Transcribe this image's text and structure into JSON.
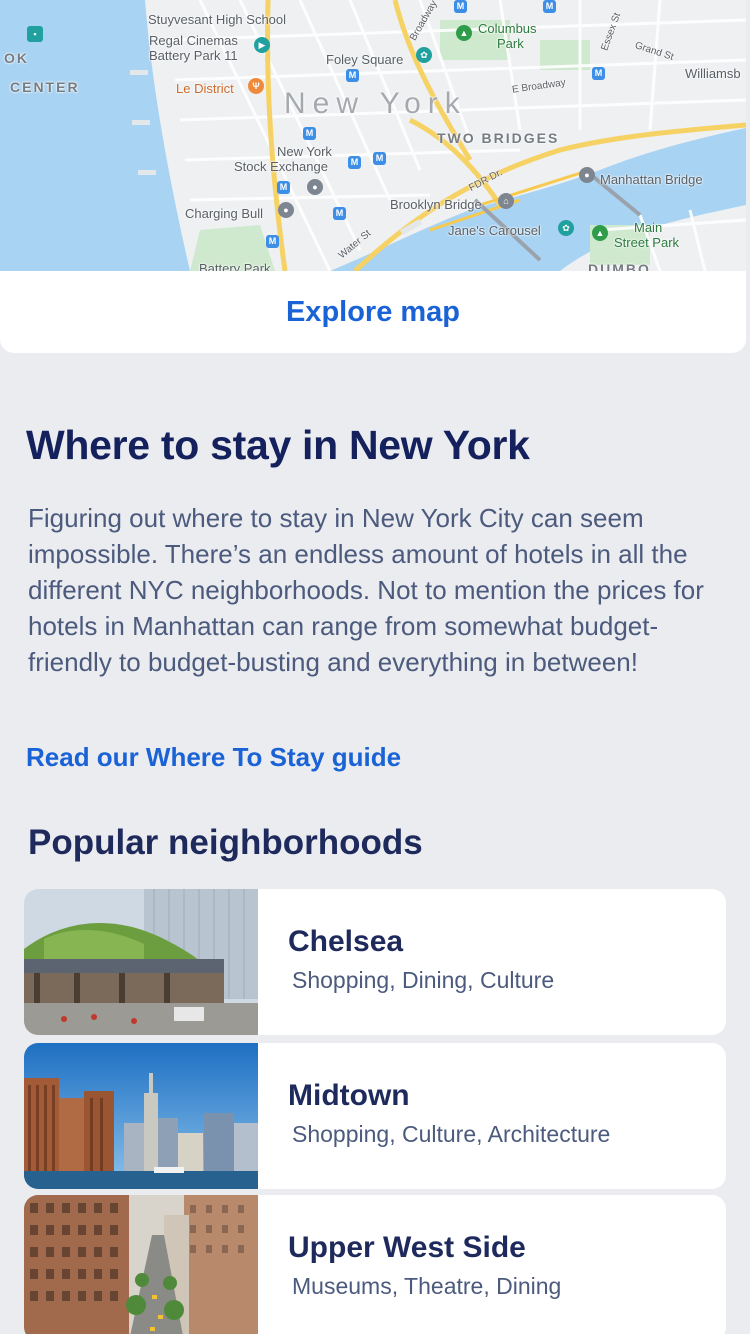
{
  "map": {
    "labels": {
      "stuyvesant": "Stuyvesant High School",
      "regal": "Regal Cinemas",
      "regal2": "Battery Park 11",
      "foley": "Foley Square",
      "columbus": "Columbus",
      "columbus2": "Park",
      "ledistrict": "Le District",
      "newyork": "New York",
      "twobridges": "TWO BRIDGES",
      "nyse": "New York",
      "nyse2": "Stock Exchange",
      "chargingbull": "Charging Bull",
      "brooklynbridge": "Brooklyn Bridge",
      "manhattanbridge": "Manhattan Bridge",
      "janescarousel": "Jane's Carousel",
      "mainstreetpark": "Main",
      "mainstreetpark2": "Street Park",
      "batterypark": "Battery Park",
      "dumbo": "DUMBO",
      "williamsburg": "Williamsb",
      "center": "CENTER",
      "ok": "OK",
      "broadway": "Broadway",
      "eastbroadway": "E Broadway",
      "grandst": "Grand St",
      "essexst": "Essex St",
      "fdrdr": "FDR Dr.",
      "waterst": "Water St"
    },
    "explore_label": "Explore map"
  },
  "where_to_stay": {
    "title": "Where to stay in New York",
    "intro": "Figuring out where to stay in New York City can seem impossible. There’s an endless amount of hotels in all the different NYC neighborhoods. Not to mention the prices for hotels in Manhattan can range from somewhat budget-friendly to budget-busting and everything in between!",
    "guide_link": "Read our Where To Stay guide"
  },
  "popular": {
    "title": "Popular neighborhoods",
    "items": [
      {
        "name": "Chelsea",
        "tags": "Shopping, Dining, Culture"
      },
      {
        "name": "Midtown",
        "tags": "Shopping, Culture, Architecture"
      },
      {
        "name": "Upper West Side",
        "tags": "Museums, Theatre, Dining"
      }
    ]
  },
  "colors": {
    "accent": "#1a63d6",
    "heading": "#14215c",
    "body_text": "#4b5a7d",
    "background": "#ebecf0",
    "water": "#a9d3f2"
  }
}
